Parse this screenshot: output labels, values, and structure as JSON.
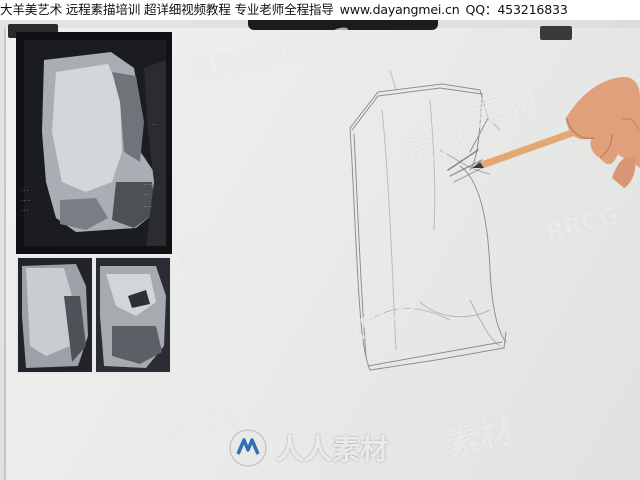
{
  "banner": {
    "course": "大羊美艺术 远程素描培训 超详细视频教程 专业老师全程指导",
    "website": "www.dayangmei.cn",
    "qq": "QQ：453216833"
  },
  "watermarks": {
    "latin": "RRCG",
    "latin_alt": "RRORRCG",
    "cn_short": "素材",
    "logo_text": "人人素材"
  },
  "colors": {
    "paper": "#eceeec",
    "pencil": "#e3a872",
    "skin": "#e0a07c",
    "photo_bg": "#0f1013"
  }
}
